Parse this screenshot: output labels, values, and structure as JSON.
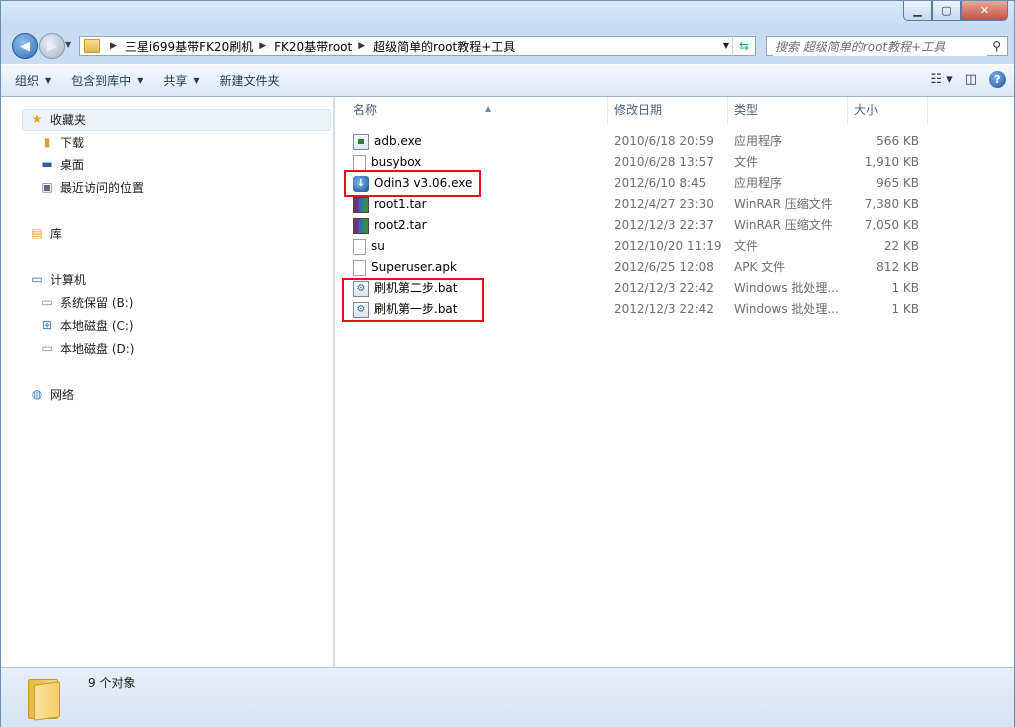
{
  "window": {
    "controls": {
      "minimize": "▁",
      "maximize": "▢",
      "close": "✕"
    }
  },
  "address": {
    "crumbs": [
      "三星i699基带FK20刷机",
      "FK20基带root",
      "超级简单的root教程+工具"
    ],
    "search_placeholder": "搜索 超级简单的root教程+工具"
  },
  "toolbar": {
    "organize": "组织",
    "include_in_library": "包含到库中",
    "share": "共享",
    "new_folder": "新建文件夹"
  },
  "sidebar": {
    "favorites": {
      "label": "收藏夹",
      "items": [
        {
          "label": "下载",
          "icon": "download-folder-icon"
        },
        {
          "label": "桌面",
          "icon": "desktop-icon"
        },
        {
          "label": "最近访问的位置",
          "icon": "recent-places-icon"
        }
      ]
    },
    "libraries": {
      "label": "库"
    },
    "computer": {
      "label": "计算机",
      "items": [
        {
          "label": "系统保留 (B:)",
          "icon": "drive-icon"
        },
        {
          "label": "本地磁盘 (C:)",
          "icon": "windows-drive-icon"
        },
        {
          "label": "本地磁盘 (D:)",
          "icon": "drive-icon"
        }
      ]
    },
    "network": {
      "label": "网络"
    }
  },
  "columns": {
    "name": "名称",
    "date": "修改日期",
    "type": "类型",
    "size": "大小"
  },
  "files": [
    {
      "name": "adb.exe",
      "date": "2010/6/18 20:59",
      "type": "应用程序",
      "size": "566 KB",
      "icon": "exe"
    },
    {
      "name": "busybox",
      "date": "2010/6/28 13:57",
      "type": "文件",
      "size": "1,910 KB",
      "icon": "doc"
    },
    {
      "name": "Odin3 v3.06.exe",
      "date": "2012/6/10 8:45",
      "type": "应用程序",
      "size": "965 KB",
      "icon": "odin"
    },
    {
      "name": "root1.tar",
      "date": "2012/4/27 23:30",
      "type": "WinRAR 压缩文件",
      "size": "7,380 KB",
      "icon": "rar"
    },
    {
      "name": "root2.tar",
      "date": "2012/12/3 22:37",
      "type": "WinRAR 压缩文件",
      "size": "7,050 KB",
      "icon": "rar"
    },
    {
      "name": "su",
      "date": "2012/10/20 11:19",
      "type": "文件",
      "size": "22 KB",
      "icon": "doc"
    },
    {
      "name": "Superuser.apk",
      "date": "2012/6/25 12:08",
      "type": "APK 文件",
      "size": "812 KB",
      "icon": "doc"
    },
    {
      "name": "刷机第二步.bat",
      "date": "2012/12/3 22:42",
      "type": "Windows 批处理...",
      "size": "1 KB",
      "icon": "bat"
    },
    {
      "name": "刷机第一步.bat",
      "date": "2012/12/3 22:42",
      "type": "Windows 批处理...",
      "size": "1 KB",
      "icon": "bat"
    }
  ],
  "status": {
    "count": "9 个对象"
  },
  "colors": {
    "highlight_box": "#e2131a"
  }
}
